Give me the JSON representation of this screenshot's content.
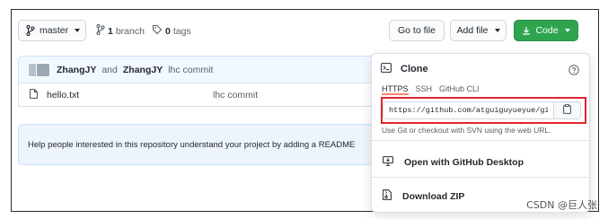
{
  "toolbar": {
    "branch_label": "master",
    "branch_count": "1",
    "branch_text": "branch",
    "tag_count": "0",
    "tag_text": "tags",
    "goto_file_label": "Go to file",
    "add_file_label": "Add file",
    "code_label": "Code"
  },
  "commit": {
    "author1": "ZhangJY",
    "and_text": "and",
    "author2": "ZhangJY",
    "message": "lhc commit"
  },
  "files": [
    {
      "name": "hello.txt",
      "message": "lhc commit"
    }
  ],
  "readme": {
    "text": "Help people interested in this repository understand your project by adding a README"
  },
  "clone": {
    "title": "Clone",
    "tabs": [
      "HTTPS",
      "SSH",
      "GitHub CLI"
    ],
    "url": "https://github.com/atguiguyueyue/git-sh",
    "hint": "Use Git or checkout with SVN using the web URL.",
    "open_desktop_label": "Open with GitHub Desktop",
    "download_zip_label": "Download ZIP"
  },
  "watermark": "CSDN @巨人张",
  "colors": {
    "code_button": "#2ea44f",
    "highlight_border": "#e0262f",
    "info_bg": "#f1f8ff"
  },
  "icons": [
    "branch-icon",
    "tag-icon",
    "download-icon",
    "file-icon",
    "terminal-icon",
    "question-icon",
    "clipboard-icon",
    "desktop-icon",
    "zip-icon"
  ]
}
